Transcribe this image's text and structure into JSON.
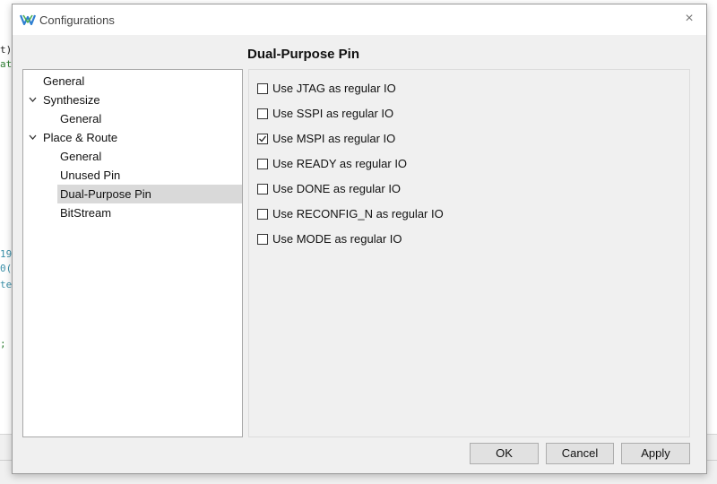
{
  "window": {
    "title": "Configurations",
    "close_glyph": "×",
    "icon": "gowin-logo-icon"
  },
  "background_code": [
    {
      "text": "t)",
      "color": "#222222"
    },
    {
      "text": "at",
      "color": "#2e7d32"
    },
    {
      "text": "19",
      "color": "#3a8fa8"
    },
    {
      "text": "0(",
      "color": "#3a8fa8"
    },
    {
      "text": "te",
      "color": "#3a8fa8"
    },
    {
      "text": ";",
      "color": "#2e7d32"
    }
  ],
  "sidebar": {
    "items": [
      {
        "label": "General"
      },
      {
        "label": "Synthesize",
        "expanded": true
      },
      {
        "label": "General"
      },
      {
        "label": "Place & Route",
        "expanded": true
      },
      {
        "label": "General"
      },
      {
        "label": "Unused Pin"
      },
      {
        "label": "Dual-Purpose Pin",
        "selected": true
      },
      {
        "label": "BitStream"
      }
    ]
  },
  "panel": {
    "title": "Dual-Purpose Pin",
    "options": [
      {
        "label": "Use JTAG as regular IO",
        "checked": false
      },
      {
        "label": "Use SSPI as regular IO",
        "checked": false
      },
      {
        "label": "Use MSPI as regular IO",
        "checked": true
      },
      {
        "label": "Use READY as regular IO",
        "checked": false
      },
      {
        "label": "Use DONE as regular IO",
        "checked": false
      },
      {
        "label": "Use RECONFIG_N as regular IO",
        "checked": false
      },
      {
        "label": "Use MODE as regular IO",
        "checked": false
      }
    ]
  },
  "buttons": {
    "ok": "OK",
    "cancel": "Cancel",
    "apply": "Apply"
  },
  "colors": {
    "dialog_bg": "#f0f0f0",
    "selected_bg": "#d9d9d9",
    "logo_blue": "#2f7fd1",
    "logo_green": "#4caf50"
  }
}
